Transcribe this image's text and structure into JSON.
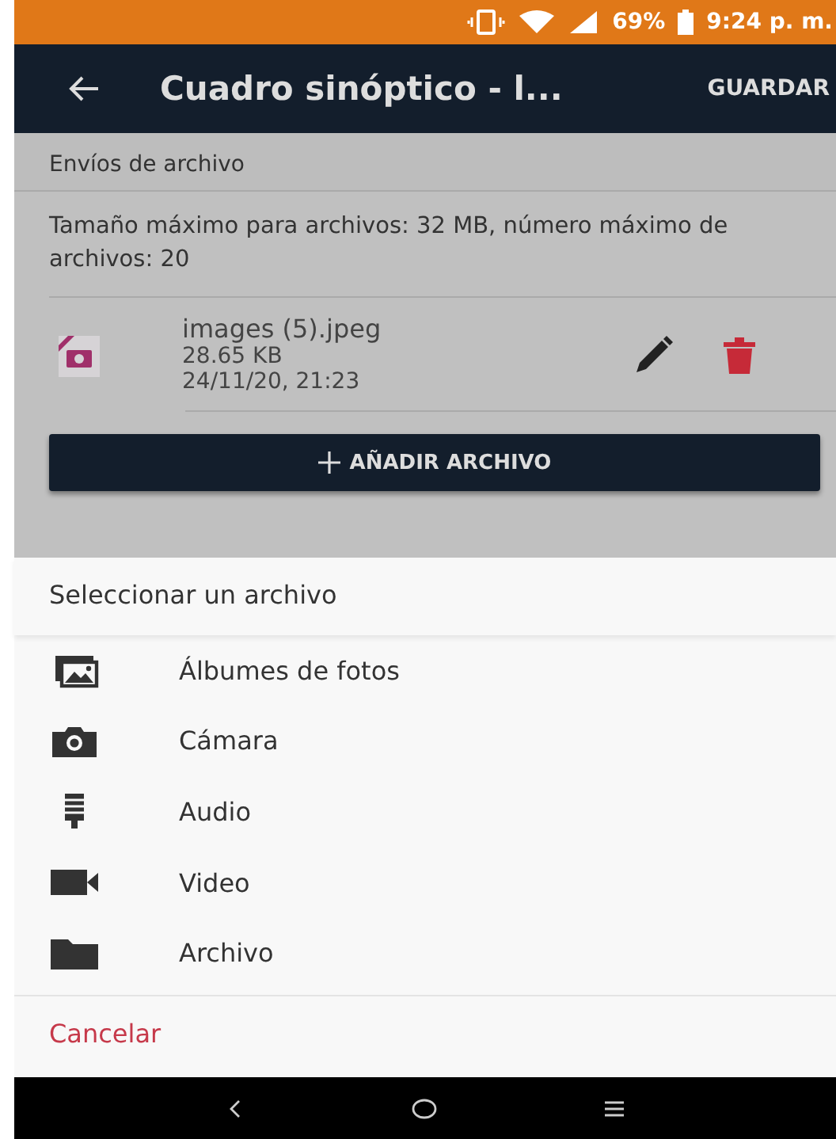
{
  "status_bar": {
    "battery": "69%",
    "time": "9:24 p. m."
  },
  "app_bar": {
    "title": "Cuadro sinóptico - l...",
    "action": "GUARDAR"
  },
  "section": {
    "title": "Envíos de archivo",
    "info": "Tamaño máximo para archivos: 32 MB, número máximo de archivos: 20"
  },
  "files": [
    {
      "name": "images (5).jpeg",
      "size": "28.65 KB",
      "date": "24/11/20, 21:23"
    }
  ],
  "add_button": "AÑADIR ARCHIVO",
  "sheet": {
    "title": "Seleccionar un archivo",
    "options": [
      {
        "kind": "albums",
        "label": "Álbumes de fotos"
      },
      {
        "kind": "camera",
        "label": "Cámara"
      },
      {
        "kind": "audio",
        "label": "Audio"
      },
      {
        "kind": "video",
        "label": "Video"
      },
      {
        "kind": "folder",
        "label": "Archivo"
      }
    ],
    "cancel": "Cancelar"
  }
}
